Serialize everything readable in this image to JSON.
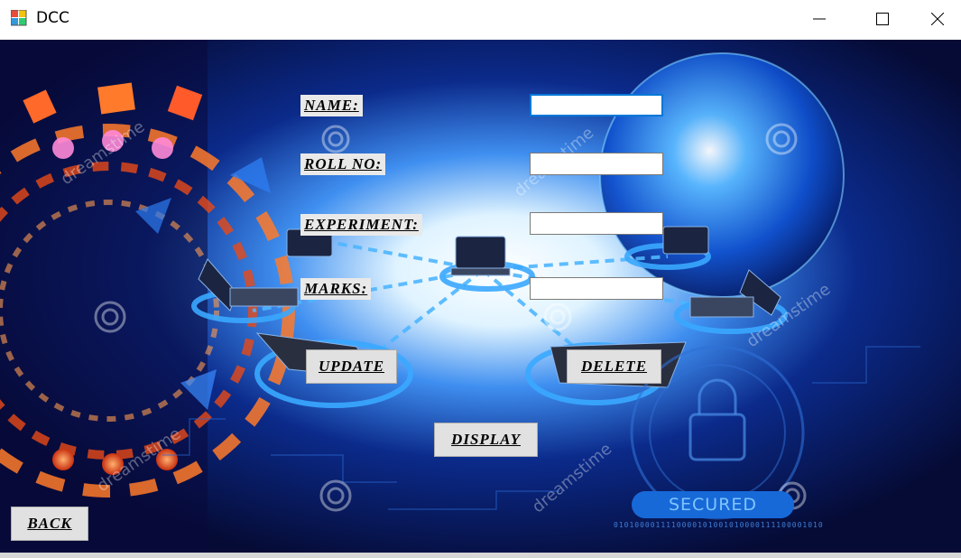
{
  "window": {
    "title": "DCC"
  },
  "form": {
    "name_label": "NAME:",
    "rollno_label": "ROLL NO:",
    "experiment_label": "EXPERIMENT:",
    "marks_label": "MARKS:",
    "name_value": "",
    "rollno_value": "",
    "experiment_value": "",
    "marks_value": ""
  },
  "buttons": {
    "update": "UPDATE",
    "delete": "DELETE",
    "display": "DISPLAY",
    "back": "BACK"
  },
  "background": {
    "badge_text": "SECURED",
    "binary_text": "0101000011110000101001010000111100001010",
    "watermark": "dreamstime"
  },
  "colors": {
    "focus": "#0078d7",
    "label_bg": "#e9e9e9",
    "button_bg": "#e1e1e1"
  }
}
